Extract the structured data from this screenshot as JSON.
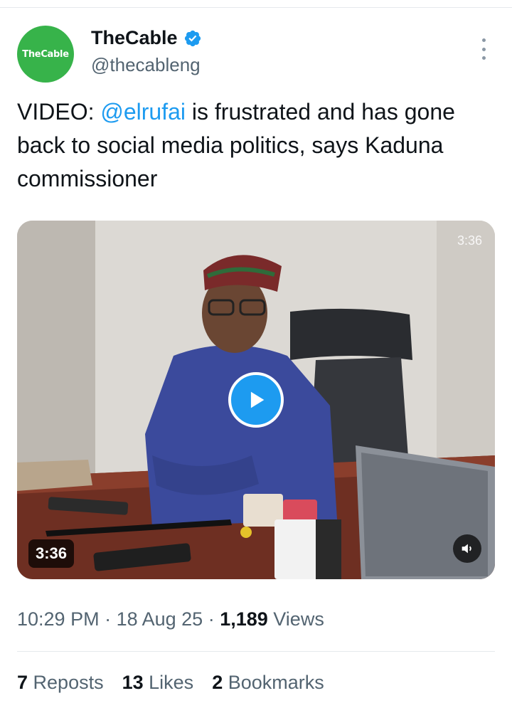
{
  "header": {
    "avatar_text": "TheCable",
    "display_name": "TheCable",
    "handle": "@thecableng",
    "verified_icon": "verified-badge-icon",
    "more_icon": "more-options-icon"
  },
  "tweet": {
    "text_prefix": "VIDEO: ",
    "mention": "@elrufai",
    "text_suffix": " is frustrated and has gone back to social media politics, says Kaduna commissioner"
  },
  "media": {
    "duration_top": "3:36",
    "duration_badge": "3:36",
    "play_icon": "play-icon",
    "volume_icon": "volume-icon"
  },
  "meta": {
    "time": "10:29 PM",
    "separator": " · ",
    "date": "18 Aug 25",
    "views_count": "1,189",
    "views_label": " Views"
  },
  "stats": {
    "reposts_count": "7",
    "reposts_label": " Reposts",
    "likes_count": "13",
    "likes_label": " Likes",
    "bookmarks_count": "2",
    "bookmarks_label": " Bookmarks"
  },
  "colors": {
    "accent": "#1d9bf0",
    "avatar_green": "#37b34a",
    "secondary_text": "#536471",
    "primary_text": "#0f1419"
  }
}
